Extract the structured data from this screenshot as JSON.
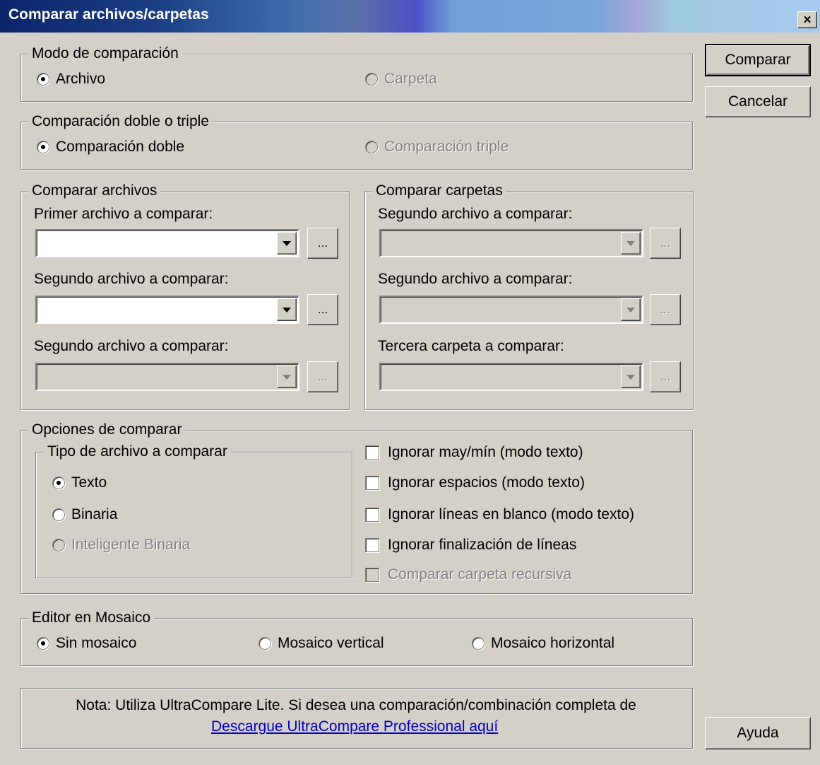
{
  "window": {
    "title": "Comparar archivos/carpetas",
    "close_glyph": "×"
  },
  "buttons": {
    "compare": "Comparar",
    "cancel": "Cancelar",
    "help": "Ayuda",
    "browse": "..."
  },
  "compare_mode": {
    "legend": "Modo de comparación",
    "options": [
      {
        "label": "Archivo",
        "selected": true,
        "enabled": true
      },
      {
        "label": "Carpeta",
        "selected": false,
        "enabled": false
      }
    ]
  },
  "double_triple": {
    "legend": "Comparación doble o triple",
    "options": [
      {
        "label": "Comparación doble",
        "selected": true,
        "enabled": true
      },
      {
        "label": "Comparación triple",
        "selected": false,
        "enabled": false
      }
    ]
  },
  "compare_files": {
    "legend": "Comparar archivos",
    "fields": [
      {
        "label": "Primer archivo a comparar:",
        "value": "",
        "enabled": true
      },
      {
        "label": "Segundo archivo a comparar:",
        "value": "",
        "enabled": true
      },
      {
        "label": "Segundo archivo a comparar:",
        "value": "",
        "enabled": false
      }
    ]
  },
  "compare_folders": {
    "legend": "Comparar carpetas",
    "fields": [
      {
        "label": "Segundo archivo a comparar:",
        "value": "",
        "enabled": false
      },
      {
        "label": "Segundo archivo a comparar:",
        "value": "",
        "enabled": false
      },
      {
        "label": "Tercera carpeta a comparar:",
        "value": "",
        "enabled": false
      }
    ]
  },
  "options": {
    "legend": "Opciones de comparar",
    "file_type": {
      "legend": "Tipo de archivo a comparar",
      "options": [
        {
          "label": "Texto",
          "selected": true,
          "enabled": true
        },
        {
          "label": "Binaria",
          "selected": false,
          "enabled": true
        },
        {
          "label": "Inteligente Binaria",
          "selected": false,
          "enabled": false
        }
      ]
    },
    "checkboxes": [
      {
        "label": "Ignorar may/mín (modo texto)",
        "checked": false,
        "enabled": true
      },
      {
        "label": "Ignorar espacios  (modo texto)",
        "checked": false,
        "enabled": true
      },
      {
        "label": "Ignorar líneas en blanco (modo texto)",
        "checked": false,
        "enabled": true
      },
      {
        "label": "Ignorar finalización de líneas",
        "checked": false,
        "enabled": true
      },
      {
        "label": "Comparar carpeta recursiva",
        "checked": false,
        "enabled": false
      }
    ]
  },
  "mosaic": {
    "legend": "Editor en Mosaico",
    "options": [
      {
        "label": "Sin mosaico",
        "selected": true,
        "enabled": true
      },
      {
        "label": "Mosaico vertical",
        "selected": false,
        "enabled": true
      },
      {
        "label": "Mosaico horizontal",
        "selected": false,
        "enabled": true
      }
    ]
  },
  "note": {
    "text": "Nota: Utiliza UltraCompare Lite.  Si desea una comparación/combinación completa de",
    "link": "Descargue UltraCompare Professional aquí"
  }
}
